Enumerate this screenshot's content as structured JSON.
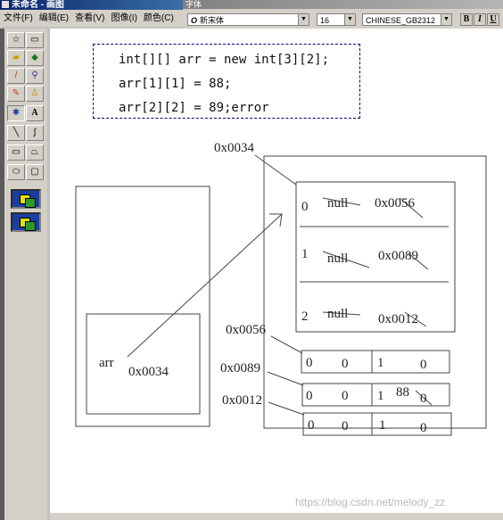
{
  "window": {
    "title": "未命名 - 画图"
  },
  "menu": [
    "文件(F)",
    "编辑(E)",
    "查看(V)",
    "图像(I)",
    "颜色(C)"
  ],
  "font_toolbar": {
    "title": "字体",
    "font_name": "新宋体",
    "font_size": "16",
    "charset": "CHINESE_GB2312",
    "bold": "B",
    "italic": "I",
    "underline": "U"
  },
  "tools": [
    "free-select",
    "rect-select",
    "eraser",
    "fill",
    "eyedropper",
    "magnifier",
    "pencil",
    "brush",
    "airbrush",
    "text",
    "line",
    "curve",
    "rectangle",
    "polygon",
    "ellipse",
    "rounded-rect"
  ],
  "code": {
    "line1": "int[][] arr = new int[3][2];",
    "line2": "arr[1][1] = 88;",
    "line3": "arr[2][2] = 89;error"
  },
  "diagram": {
    "outer_addr": "0x0034",
    "arr_label": "arr",
    "arr_value": "0x0034",
    "rows": [
      {
        "index": "0",
        "old": "null",
        "ref": "0x0056"
      },
      {
        "index": "1",
        "old": "null",
        "ref": "0x0089"
      },
      {
        "index": "2",
        "old": "null",
        "ref": "0x0012"
      }
    ],
    "inner": [
      {
        "addr": "0x0056",
        "c0_idx": "0",
        "c0_val": "0",
        "c1_idx": "1",
        "c1_val": "0"
      },
      {
        "addr": "0x0089",
        "c0_idx": "0",
        "c0_val": "0",
        "c1_idx": "1",
        "c1_new": "88",
        "c1_val": "0"
      },
      {
        "addr": "0x0012",
        "c0_idx": "0",
        "c0_val": "0",
        "c1_idx": "1",
        "c1_val": "0"
      }
    ]
  },
  "watermark": "https://blog.csdn.net/melody_zz"
}
